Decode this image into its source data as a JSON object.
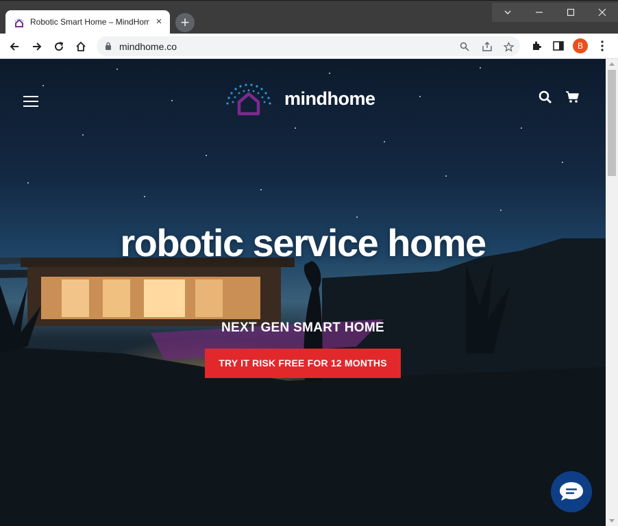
{
  "browser": {
    "tab_title": "Robotic Smart Home – MindHome",
    "tab_close": "×",
    "new_tab": "+",
    "url": "mindhome.co",
    "profile_initial": "B",
    "window": {
      "tab_search": "⌄",
      "minimize": "—",
      "maximize": "☐",
      "close": "✕"
    }
  },
  "site": {
    "brand": "mindhome",
    "hero": {
      "title": "robotic service home",
      "subtitle": "NEXT GEN SMART HOME",
      "cta_label": "TRY IT RISK FREE FOR 12 MONTHS"
    },
    "colors": {
      "cta": "#e2282b",
      "chat": "#0e3f86",
      "logo_house": "#7b2a8f",
      "logo_dots": "#2d9bdc"
    }
  }
}
